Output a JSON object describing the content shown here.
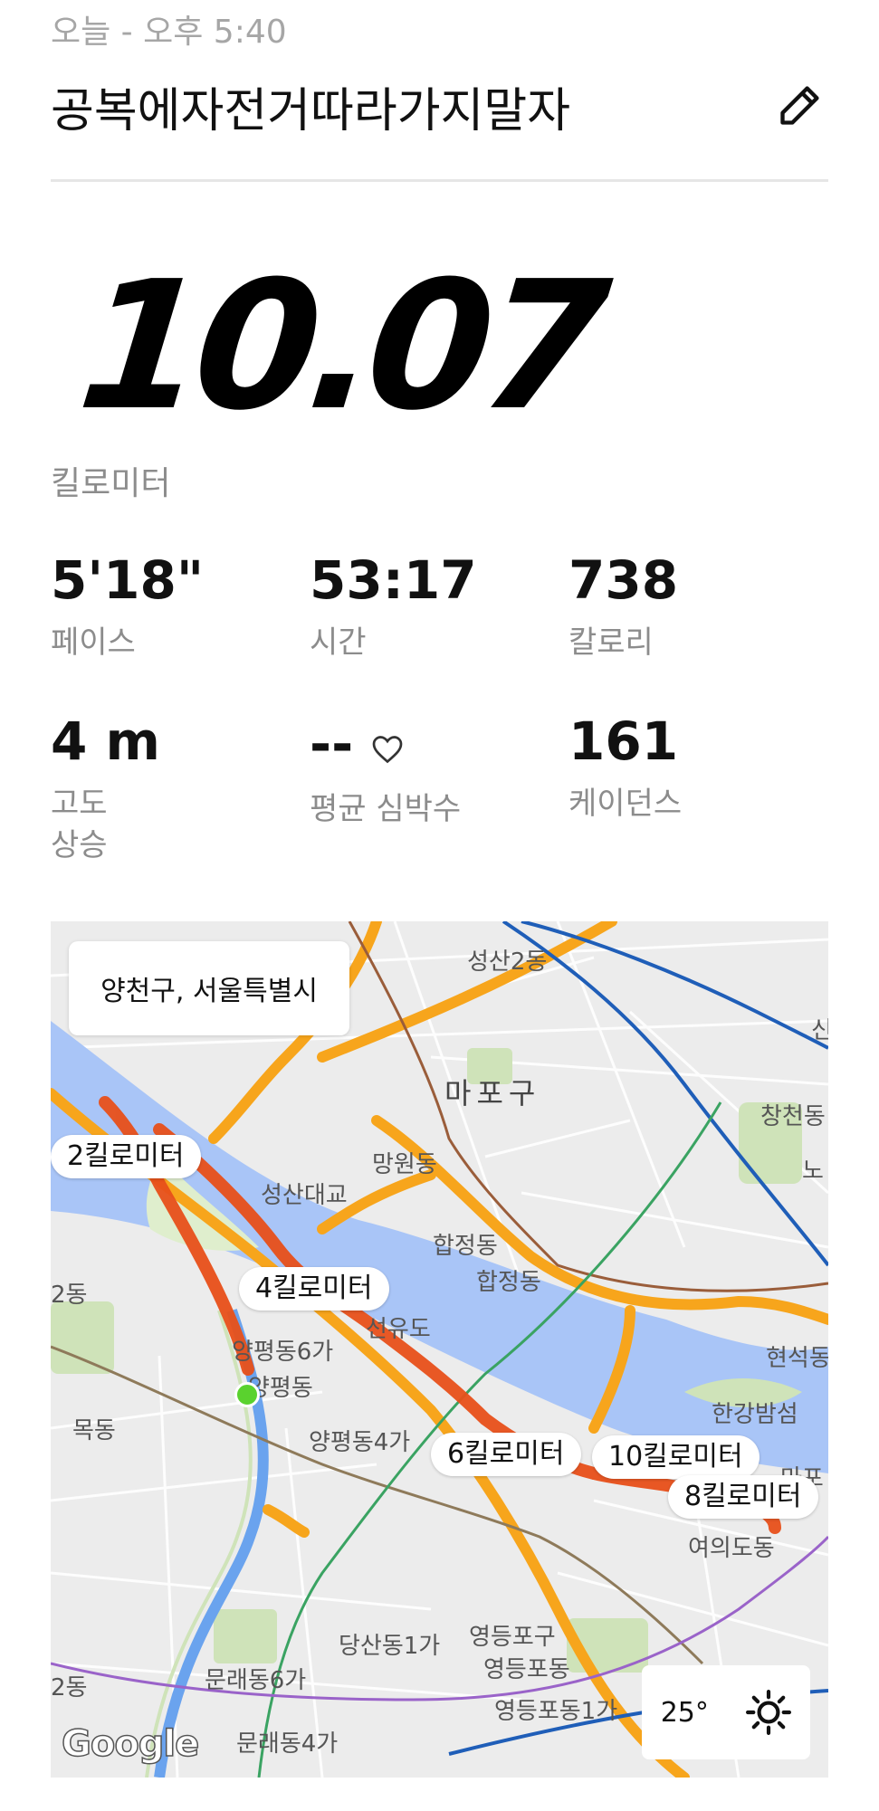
{
  "header": {
    "timestamp": "오늘 - 오후 5:40",
    "title": "공복에자전거따라가지말자",
    "edit_icon": "pencil-icon"
  },
  "summary": {
    "distance": "10.07",
    "distance_unit": "킬로미터"
  },
  "stats": {
    "pace": {
      "value": "5'18\"",
      "label": "페이스"
    },
    "time": {
      "value": "53:17",
      "label": "시간"
    },
    "calories": {
      "value": "738",
      "label": "칼로리"
    },
    "elevation": {
      "value": "4 m",
      "label": "고도\n상승"
    },
    "heart_rate": {
      "value": "--",
      "label": "평균 심박수",
      "icon": "heart-icon"
    },
    "cadence": {
      "value": "161",
      "label": "케이던스"
    }
  },
  "map": {
    "location": "양천구, 서울특별시",
    "km_markers": [
      "2킬로미터",
      "4킬로미터",
      "6킬로미터",
      "10킬로미터",
      "8킬로미터"
    ],
    "place_labels": [
      "성산2동",
      "마포구",
      "창천동",
      "망원동",
      "성산대교",
      "합정동",
      "합정동",
      "선유도",
      "양평동6가",
      "양평동",
      "양평동4가",
      "목동",
      "한강밤섬",
      "현석동",
      "여의도동",
      "영등포구",
      "영등포동",
      "영등포동1가",
      "당산동1가",
      "문래동6가",
      "문래동4가",
      "신",
      "노",
      "마포",
      "2동",
      "2동"
    ],
    "weather": {
      "temperature": "25°",
      "icon": "sun-icon"
    },
    "attribution": "Google"
  },
  "colors": {
    "route": "#e8501a",
    "river": "#a9c5f7",
    "highway": "#f7a51c",
    "start": "#5ad22e"
  }
}
